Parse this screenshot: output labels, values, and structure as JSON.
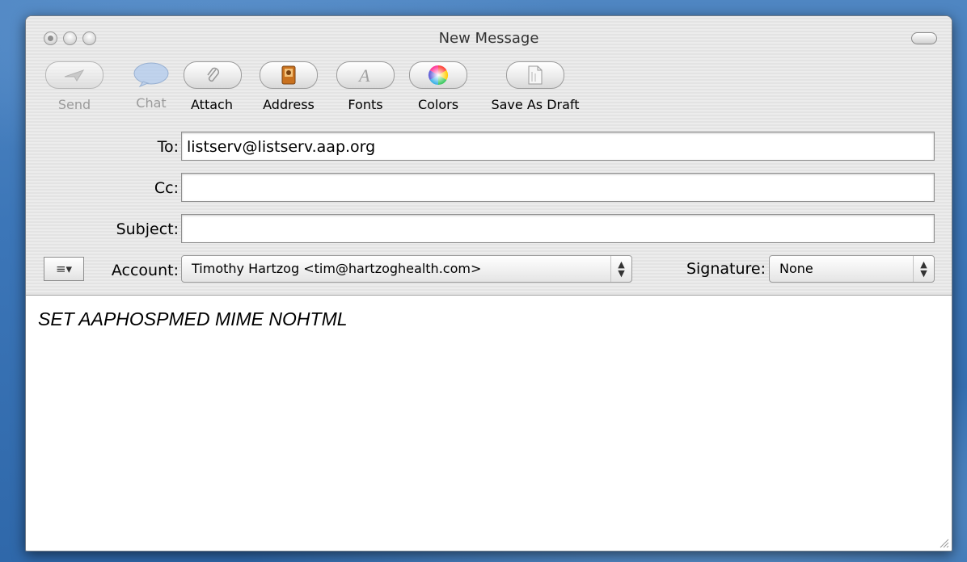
{
  "window": {
    "title": "New Message"
  },
  "toolbar": {
    "buttons": [
      {
        "label": "Send",
        "icon": "send-icon",
        "enabled": false
      },
      {
        "label": "Chat",
        "icon": "chat-bubble-icon",
        "enabled": false
      },
      {
        "label": "Attach",
        "icon": "paperclip-icon",
        "enabled": true
      },
      {
        "label": "Address",
        "icon": "address-book-icon",
        "enabled": true
      },
      {
        "label": "Fonts",
        "icon": "fonts-icon",
        "enabled": true
      },
      {
        "label": "Colors",
        "icon": "color-wheel-icon",
        "enabled": true
      },
      {
        "label": "Save As Draft",
        "icon": "draft-document-icon",
        "enabled": true
      }
    ]
  },
  "headers": {
    "to_label": "To:",
    "to_value": "listserv@listserv.aap.org",
    "cc_label": "Cc:",
    "cc_value": "",
    "subject_label": "Subject:",
    "subject_value": "",
    "account_label": "Account:",
    "account_value": "Timothy Hartzog <tim@hartzoghealth.com>",
    "signature_label": "Signature:",
    "signature_value": "None"
  },
  "message": {
    "body": "SET AAPHOSPMED MIME NOHTML"
  },
  "colors": {
    "desktop": "#3c76b8",
    "chat_blue": "#8fb6e6",
    "address_orange": "#d98a2b"
  }
}
